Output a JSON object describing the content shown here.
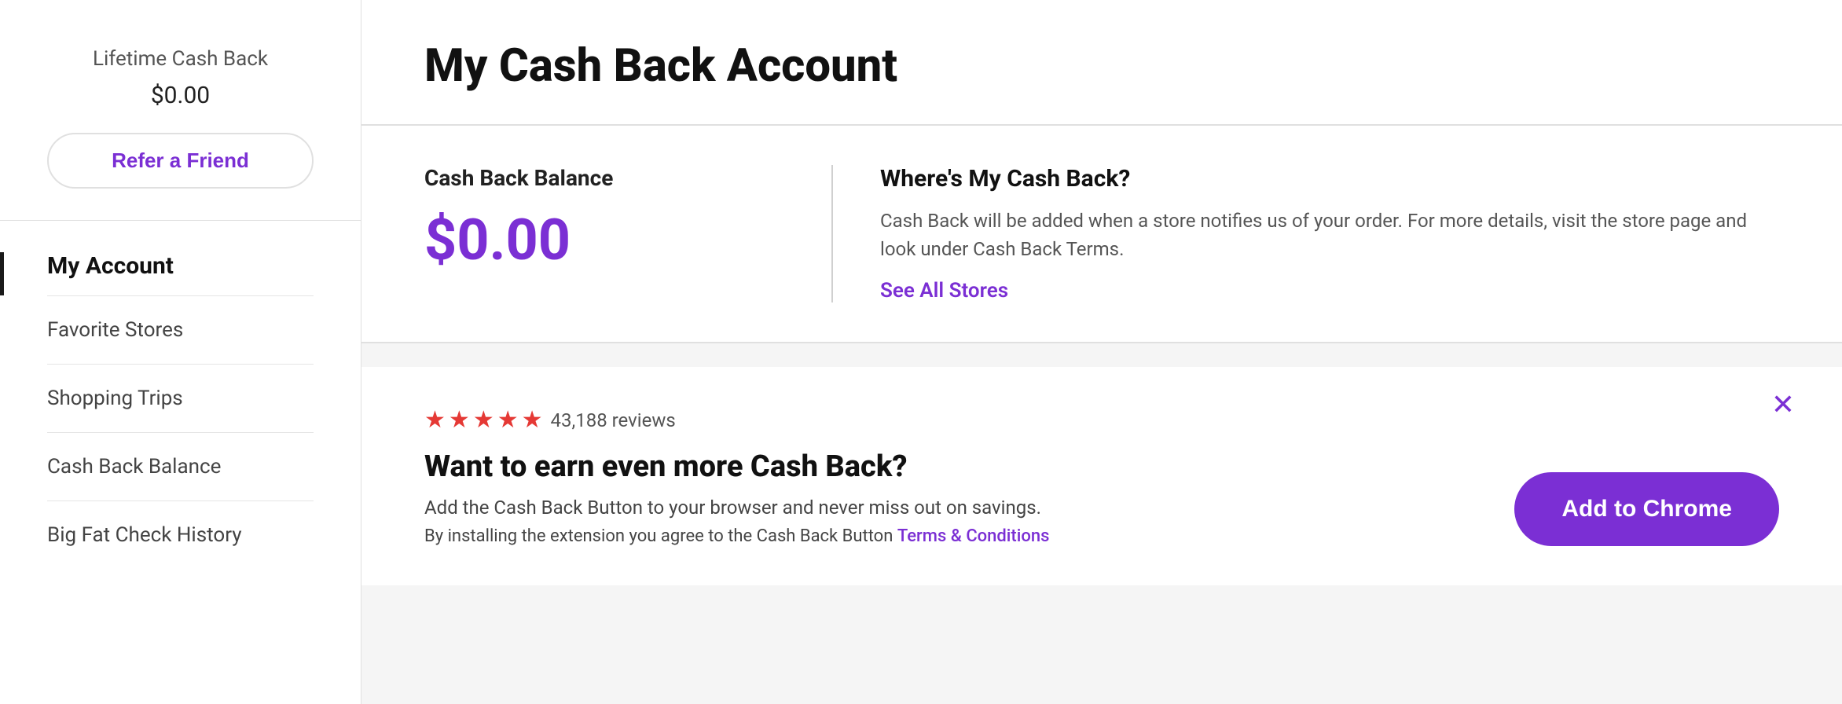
{
  "sidebar": {
    "lifetime_label": "Lifetime Cash Back",
    "lifetime_amount": "$0.00",
    "refer_btn_label": "Refer a Friend",
    "my_account_heading": "My Account",
    "nav_items": [
      {
        "label": "Favorite Stores"
      },
      {
        "label": "Shopping Trips"
      },
      {
        "label": "Cash Back Balance"
      },
      {
        "label": "Big Fat Check History"
      }
    ]
  },
  "main": {
    "page_title": "My Cash Back Account",
    "balance_card": {
      "balance_label": "Cash Back Balance",
      "balance_amount": "$0.00",
      "info_title": "Where's My Cash Back?",
      "info_text": "Cash Back will be added when a store notifies us of your order. For more details, visit the store page and look under Cash Back Terms.",
      "see_all_stores": "See All Stores"
    },
    "promo_card": {
      "review_count": "43,188 reviews",
      "promo_title": "Want to earn even more Cash Back?",
      "promo_desc": "Add the Cash Back Button to your browser and never miss out on savings.",
      "promo_terms_prefix": "By installing the extension you agree to the Cash Back Button ",
      "promo_terms_link": "Terms & Conditions",
      "add_to_chrome_label": "Add to Chrome",
      "close_icon": "✕"
    }
  },
  "colors": {
    "purple": "#7b2fd4",
    "red_star": "#e53935"
  }
}
